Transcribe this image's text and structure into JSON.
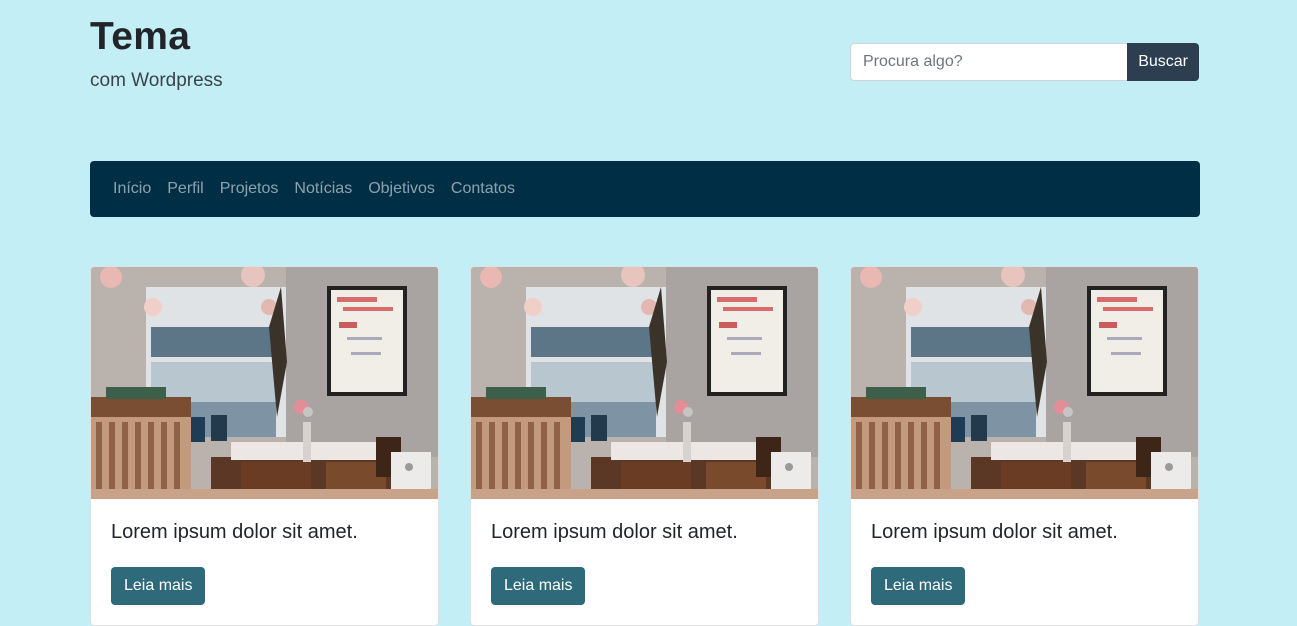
{
  "site": {
    "title": "Tema",
    "subtitle": "com Wordpress"
  },
  "search": {
    "placeholder": "Procura algo?",
    "value": "",
    "button_label": "Buscar"
  },
  "nav": {
    "items": [
      {
        "label": "Início"
      },
      {
        "label": "Perfil"
      },
      {
        "label": "Projetos"
      },
      {
        "label": "Notícias"
      },
      {
        "label": "Objetivos"
      },
      {
        "label": "Contatos"
      }
    ]
  },
  "posts": [
    {
      "title": "Lorem ipsum dolor sit amet.",
      "button_label": "Leia mais",
      "image": "cafe-interior-photo"
    },
    {
      "title": "Lorem ipsum dolor sit amet.",
      "button_label": "Leia mais",
      "image": "cafe-interior-photo"
    },
    {
      "title": "Lorem ipsum dolor sit amet.",
      "button_label": "Leia mais",
      "image": "cafe-interior-photo"
    }
  ],
  "colors": {
    "page_background": "#c4eef6",
    "navbar": "#002f45",
    "search_button": "#2c3e50",
    "read_more_button": "#2e6a79"
  }
}
